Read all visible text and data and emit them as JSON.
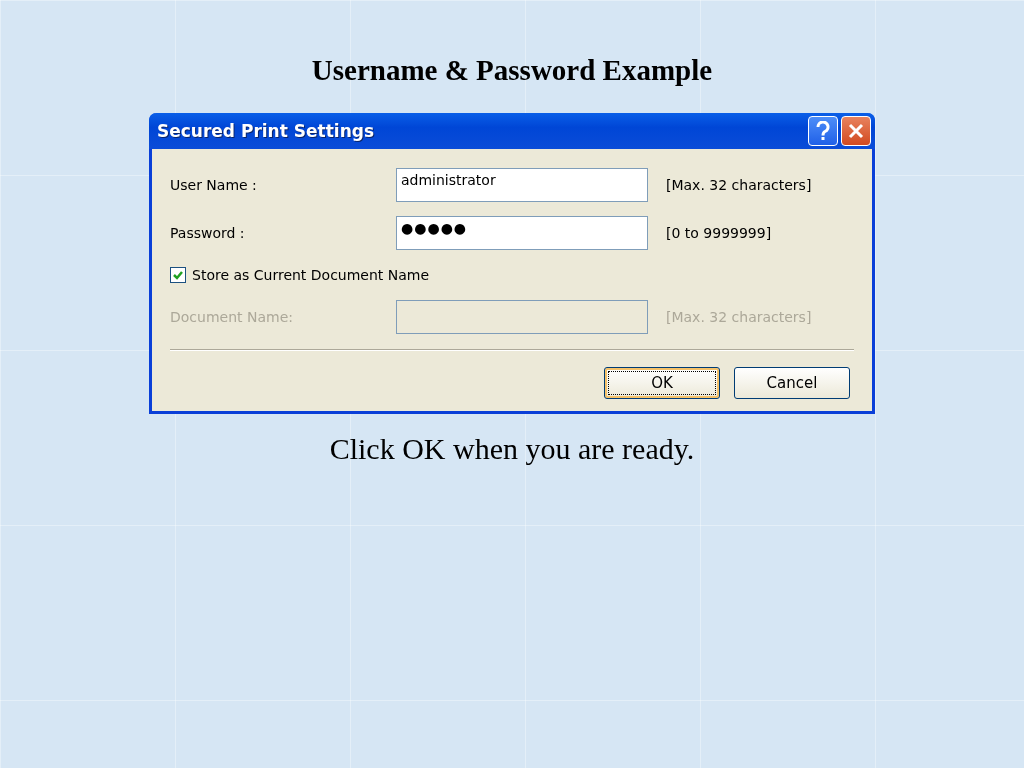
{
  "slide": {
    "title": "Username & Password Example",
    "caption": "Click OK when you are ready."
  },
  "dialog": {
    "title": "Secured Print Settings",
    "fields": [
      {
        "kind": "text",
        "label": "User Name :",
        "value": "administrator",
        "hint": "[Max. 32 characters]",
        "disabled": false
      },
      {
        "kind": "password",
        "label": "Password :",
        "value": "●●●●●",
        "hint": "[0 to 9999999]",
        "disabled": false
      },
      {
        "kind": "checkbox",
        "label": "Store as Current Document Name",
        "checked": true
      },
      {
        "kind": "text",
        "label": "Document Name:",
        "hint": "[Max. 32 characters]",
        "disabled": true
      }
    ],
    "buttons": [
      {
        "label": "OK",
        "default": true
      },
      {
        "label": "Cancel",
        "default": false
      }
    ]
  }
}
